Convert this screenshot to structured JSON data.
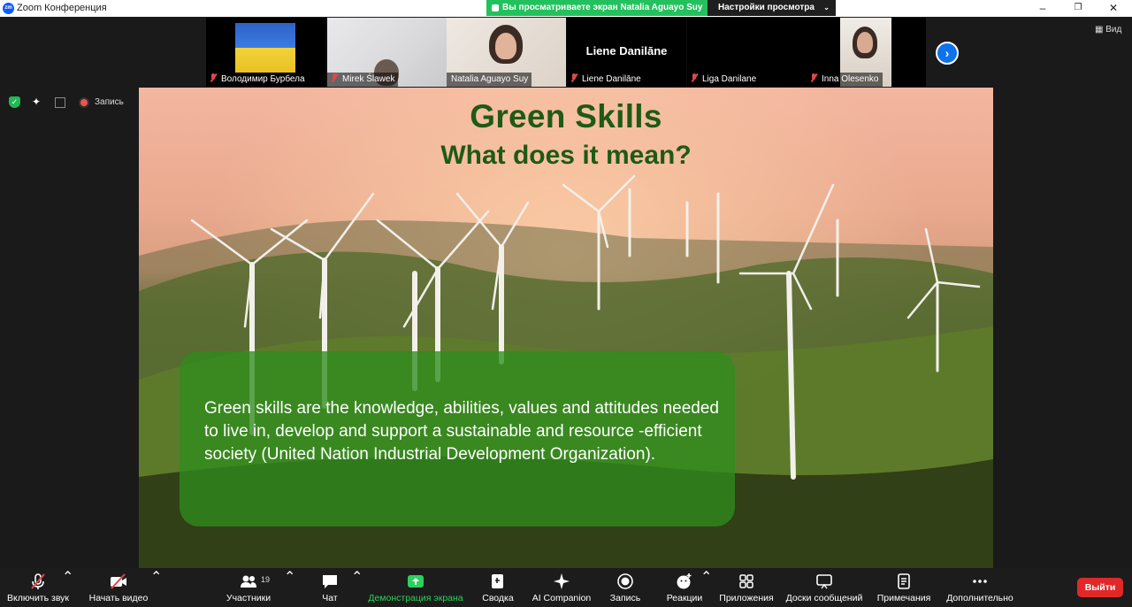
{
  "window": {
    "title": "Zoom Конференция",
    "logo_text": "zm",
    "share_banner": "Вы просматриваете экран Natalia Aguayo Suy",
    "view_settings": "Настройки просмотра",
    "minimize": "–",
    "restore": "❐",
    "close": "✕"
  },
  "gallery": {
    "participants": [
      {
        "name": "Володимир Бурбела"
      },
      {
        "name": "Mirek Ślawek"
      },
      {
        "name": "Natalia Aguayo Suy"
      },
      {
        "name": "Liene Danilāne",
        "display_name": "Liene Danilāne"
      },
      {
        "name": "Liga Danilane"
      },
      {
        "name": "Inna Olesenko"
      }
    ],
    "next_arrow": "›",
    "view_label": "Вид"
  },
  "indicators": {
    "record_label": "Запись"
  },
  "slide": {
    "title": "Green Skills",
    "subtitle": "What does it mean?",
    "body": "Green skills are the knowledge, abilities, values and attitudes needed to live in, develop and support a sustainable and resource -efficient society (United Nation Industrial Development Organization)."
  },
  "toolbar": {
    "items": [
      {
        "label": "Включить звук",
        "icon": "mic-muted-icon"
      },
      {
        "label": "Начать видео",
        "icon": "video-off-icon"
      },
      {
        "label": "Участники",
        "icon": "participants-icon",
        "count": "19"
      },
      {
        "label": "Чат",
        "icon": "chat-icon"
      },
      {
        "label": "Демонстрация экрана",
        "icon": "share-screen-icon"
      },
      {
        "label": "Сводка",
        "icon": "summary-icon"
      },
      {
        "label": "AI Companion",
        "icon": "ai-companion-icon"
      },
      {
        "label": "Запись",
        "icon": "record-icon"
      },
      {
        "label": "Реакции",
        "icon": "reactions-icon"
      },
      {
        "label": "Приложения",
        "icon": "apps-icon"
      },
      {
        "label": "Доски сообщений",
        "icon": "whiteboard-icon"
      },
      {
        "label": "Примечания",
        "icon": "notes-icon"
      },
      {
        "label": "Дополнительно",
        "icon": "more-icon"
      }
    ],
    "exit_label": "Выйти"
  },
  "colors": {
    "share_green": "#23c15d",
    "share_label_green": "#2bd15c",
    "exit_red": "#e02828",
    "slide_title": "#1e5a16",
    "zoom_blue": "#0e72ed"
  }
}
